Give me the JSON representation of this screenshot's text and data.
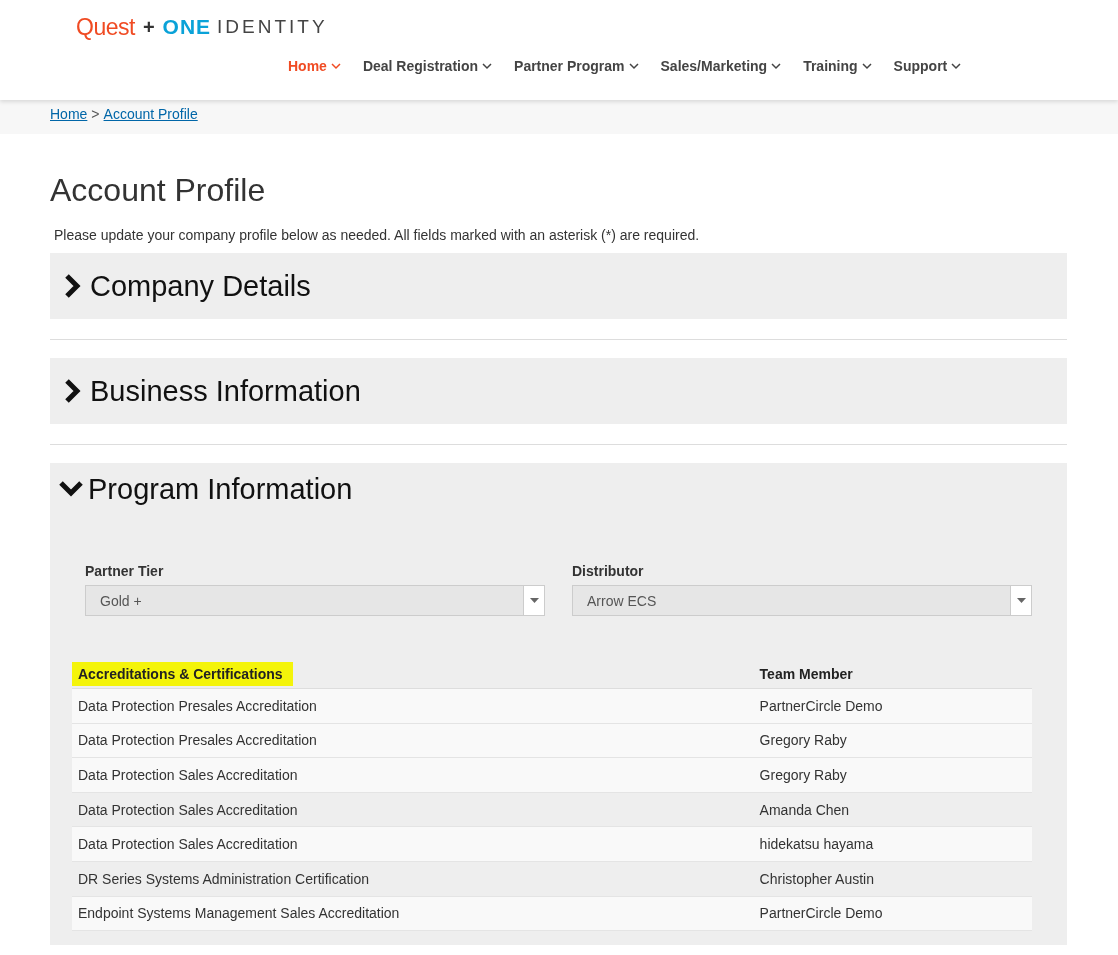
{
  "logo": {
    "brand": "Quest",
    "plus": "+",
    "partner_bold": "ONE",
    "partner_light": "IDENTITY"
  },
  "nav": [
    {
      "label": "Home",
      "selected": true
    },
    {
      "label": "Deal Registration",
      "selected": false
    },
    {
      "label": "Partner Program",
      "selected": false
    },
    {
      "label": "Sales/Marketing",
      "selected": false
    },
    {
      "label": "Training",
      "selected": false
    },
    {
      "label": "Support",
      "selected": false
    }
  ],
  "breadcrumb": {
    "items": [
      "Home",
      "Account Profile"
    ],
    "separator": ">"
  },
  "page": {
    "title": "Account Profile",
    "intro": "Please update your company profile below as needed. All fields marked with an asterisk (*) are required."
  },
  "sections": [
    {
      "title": "Company Details",
      "expanded": false
    },
    {
      "title": "Business Information",
      "expanded": false
    },
    {
      "title": "Program Information",
      "expanded": true
    }
  ],
  "program": {
    "fields": [
      {
        "label": "Partner Tier",
        "value": "Gold +"
      },
      {
        "label": "Distributor",
        "value": "Arrow ECS"
      }
    ],
    "table": {
      "columns": [
        {
          "label": "Accreditations & Certifications",
          "highlighted": true
        },
        {
          "label": "Team Member",
          "highlighted": false
        }
      ],
      "rows": [
        [
          "Data Protection Presales Accreditation",
          "PartnerCircle Demo"
        ],
        [
          "Data Protection Presales Accreditation",
          "Gregory Raby"
        ],
        [
          "Data Protection Sales Accreditation",
          "Gregory Raby"
        ],
        [
          "Data Protection Sales Accreditation",
          "Amanda Chen"
        ],
        [
          "Data Protection Sales Accreditation",
          "hidekatsu hayama"
        ],
        [
          "DR Series Systems Administration Certification",
          "Christopher Austin"
        ],
        [
          "Endpoint Systems Management Sales Accreditation",
          "PartnerCircle Demo"
        ]
      ]
    }
  }
}
